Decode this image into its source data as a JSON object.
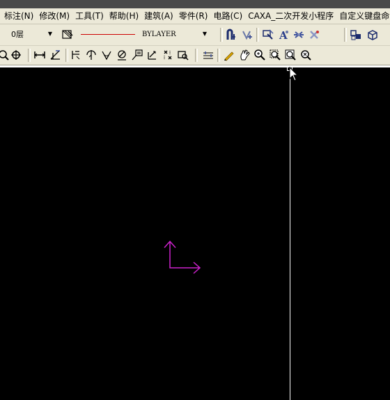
{
  "menu": {
    "items": [
      {
        "label": "标注(N)",
        "name": "menu-dimension"
      },
      {
        "label": "修改(M)",
        "name": "menu-modify"
      },
      {
        "label": "工具(T)",
        "name": "menu-tools"
      },
      {
        "label": "帮助(H)",
        "name": "menu-help"
      },
      {
        "label": "建筑(A)",
        "name": "menu-architecture"
      },
      {
        "label": "零件(R)",
        "name": "menu-parts"
      },
      {
        "label": "电路(C)",
        "name": "menu-circuit"
      },
      {
        "label": "CAXA_二次开发小程序",
        "name": "menu-caxa"
      },
      {
        "label": "自定义键盘命令",
        "name": "menu-custom-keyboard"
      }
    ]
  },
  "properties": {
    "layer_value": "0层",
    "linetype_value": "BYLAYER",
    "linetype_color": "#cc0000"
  },
  "colors": {
    "toolbar_bg": "#ece9d8",
    "canvas_bg": "#000000",
    "ucs_color": "#cc22cc",
    "crosshair": "#ffffff"
  }
}
